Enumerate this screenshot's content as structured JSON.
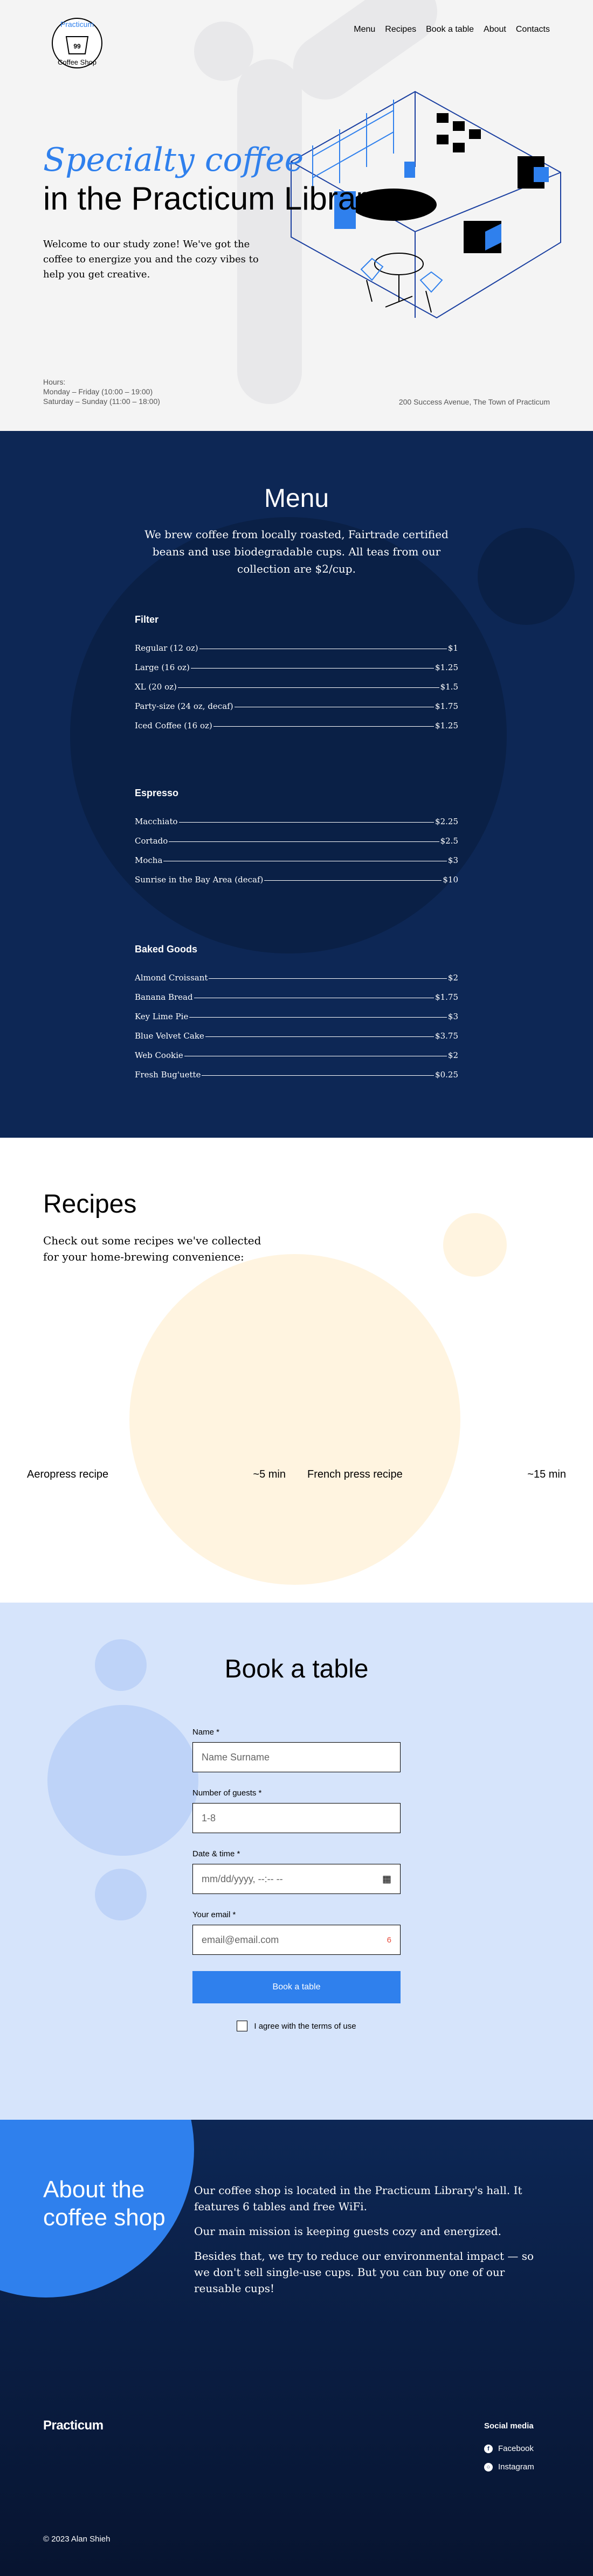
{
  "header": {
    "logo_top": "Practicum",
    "logo_bottom": "Coffee Shop",
    "logo_mark": "99",
    "nav": [
      "Menu",
      "Recipes",
      "Book a table",
      "About",
      "Contacts"
    ]
  },
  "hero": {
    "title_line1": "Specialty coffee",
    "title_line2": "in the Practicum Library",
    "text": "Welcome to our study zone! We've got the coffee to energize you and the cozy vibes to help you get creative.",
    "hours_label": "Hours:",
    "hours_weekday": "Monday – Friday (10:00 – 19:00)",
    "hours_weekend": "Saturday – Sunday (11:00 – 18:00)",
    "address": "200 Success Avenue, The Town of Practicum"
  },
  "menu": {
    "title": "Menu",
    "subtitle": "We brew coffee from locally roasted, Fairtrade certified beans and use biodegradable cups. All teas from our collection are $2/cup.",
    "categories": [
      {
        "name": "Filter",
        "items": [
          {
            "name": "Regular (12 oz)",
            "price": "$1"
          },
          {
            "name": "Large (16 oz)",
            "price": "$1.25"
          },
          {
            "name": "XL (20 oz)",
            "price": "$1.5"
          },
          {
            "name": "Party-size (24 oz, decaf)",
            "price": "$1.75"
          },
          {
            "name": "Iced Coffee (16 oz)",
            "price": "$1.25"
          }
        ]
      },
      {
        "name": "Espresso",
        "items": [
          {
            "name": "Macchiato",
            "price": "$2.25"
          },
          {
            "name": "Cortado",
            "price": "$2.5"
          },
          {
            "name": "Mocha",
            "price": "$3"
          },
          {
            "name": "Sunrise in the Bay Area (decaf)",
            "price": "$10"
          }
        ]
      },
      {
        "name": "Baked Goods",
        "items": [
          {
            "name": "Almond Croissant",
            "price": "$2"
          },
          {
            "name": "Banana Bread",
            "price": "$1.75"
          },
          {
            "name": "Key Lime Pie",
            "price": "$3"
          },
          {
            "name": "Blue Velvet Cake",
            "price": "$3.75"
          },
          {
            "name": "Web Cookie",
            "price": "$2"
          },
          {
            "name": "Fresh Bug'uette",
            "price": "$0.25"
          }
        ]
      }
    ]
  },
  "recipes": {
    "title": "Recipes",
    "subtitle": "Check out some recipes we've collected for your home-brewing convenience:",
    "cards": [
      {
        "name": "Aeropress recipe",
        "time": "~5 min"
      },
      {
        "name": "French press recipe",
        "time": "~15 min"
      }
    ]
  },
  "book": {
    "title": "Book a table",
    "name_label": "Name *",
    "name_placeholder": "Name Surname",
    "guests_label": "Number of guests *",
    "guests_placeholder": "1-8",
    "date_label": "Date & time *",
    "date_placeholder": "mm/dd/yyyy, --:-- --",
    "email_label": "Your email *",
    "email_placeholder": "email@email.com",
    "submit": "Book a table",
    "agree": "I agree with the terms of use"
  },
  "about": {
    "title_line1": "About the",
    "title_line2": "coffee shop",
    "p1": "Our coffee shop is located in the Practicum Library's hall. It features 6 tables and free WiFi.",
    "p2": "Our main mission is keeping guests cozy and energized.",
    "p3": "Besides that, we try to reduce our environmental impact — so we don't sell single-use cups. But you can buy one of our reusable cups!"
  },
  "footer": {
    "logo": "Practicum",
    "social_title": "Social media",
    "facebook": "Facebook",
    "instagram": "Instagram",
    "copyright": "© 2023 Alan Shieh"
  },
  "colors": {
    "accent": "#2f80ed",
    "navy": "#0d2755",
    "light_blue": "#d6e4fb",
    "cream": "#fff4e0"
  }
}
